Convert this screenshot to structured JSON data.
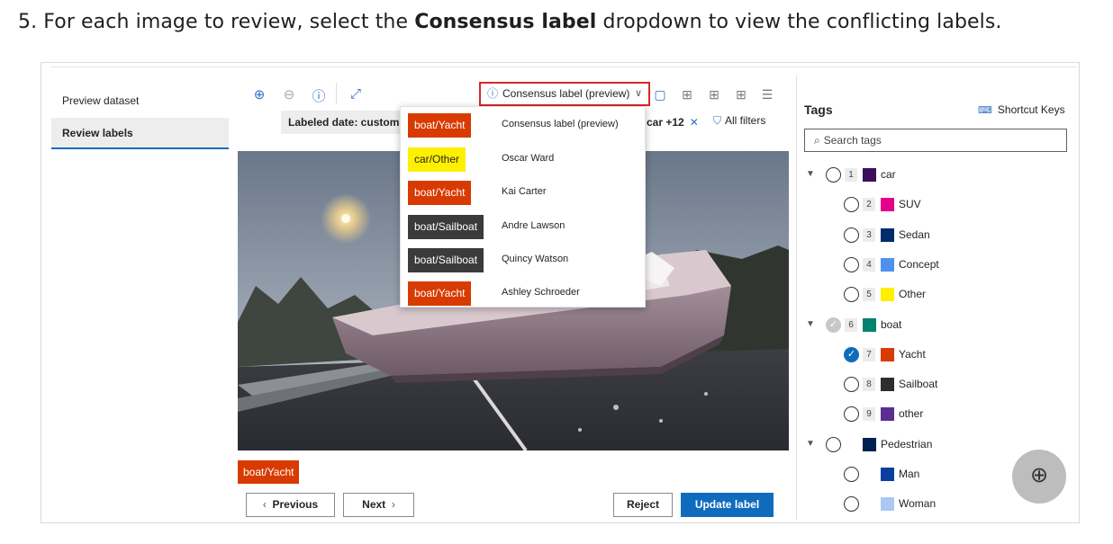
{
  "instruction": {
    "prefix": "5. For each image to review, select the ",
    "bold": "Consensus label",
    "suffix": " dropdown to view the conflicting labels."
  },
  "nav": {
    "preview_dataset": "Preview dataset",
    "review_labels": "Review labels"
  },
  "toolbar": {
    "zoom_in_icon": "zoom-in-icon",
    "zoom_out_icon": "zoom-out-icon",
    "info_icon": "info-icon",
    "expand_icon": "expand-icon",
    "consensus_label": "Consensus label (preview)",
    "filter_labeled_date": "Labeled date: custom",
    "filter_car": "car +12",
    "all_filters": "All filters"
  },
  "dropdown": {
    "rows": [
      {
        "badge": "boat/Yacht",
        "name": "Consensus label (preview)",
        "bg": "#d83b01",
        "fg": "#ffffff"
      },
      {
        "badge": "car/Other",
        "name": "Oscar Ward",
        "bg": "#ffef00",
        "fg": "#242424"
      },
      {
        "badge": "boat/Yacht",
        "name": "Kai Carter",
        "bg": "#d83b01",
        "fg": "#ffffff"
      },
      {
        "badge": "boat/Sailboat",
        "name": "Andre Lawson",
        "bg": "#3b3b3b",
        "fg": "#ffffff"
      },
      {
        "badge": "boat/Sailboat",
        "name": "Quincy Watson",
        "bg": "#3b3b3b",
        "fg": "#ffffff"
      },
      {
        "badge": "boat/Yacht",
        "name": "Ashley Schroeder",
        "bg": "#d83b01",
        "fg": "#ffffff"
      }
    ]
  },
  "image_label": "boat/Yacht",
  "buttons": {
    "previous": "Previous",
    "next": "Next",
    "reject": "Reject",
    "update": "Update label"
  },
  "tags_panel": {
    "title": "Tags",
    "shortcut_keys": "Shortcut Keys",
    "search_placeholder": "Search tags",
    "tags": [
      {
        "num": "1",
        "name": "car",
        "color": "#3b0f5c",
        "state": "empty",
        "group": true
      },
      {
        "num": "2",
        "name": "SUV",
        "color": "#e3008c",
        "state": "empty",
        "group": false
      },
      {
        "num": "3",
        "name": "Sedan",
        "color": "#002c6c",
        "state": "empty",
        "group": false
      },
      {
        "num": "4",
        "name": "Concept",
        "color": "#4f8ff0",
        "state": "empty",
        "group": false
      },
      {
        "num": "5",
        "name": "Other",
        "color": "#ffef00",
        "state": "empty",
        "group": false
      },
      {
        "num": "6",
        "name": "boat",
        "color": "#00826f",
        "state": "partial",
        "group": true
      },
      {
        "num": "7",
        "name": "Yacht",
        "color": "#d83b01",
        "state": "checked",
        "group": false
      },
      {
        "num": "8",
        "name": "Sailboat",
        "color": "#2e2e2e",
        "state": "empty",
        "group": false
      },
      {
        "num": "9",
        "name": "other",
        "color": "#5c2e91",
        "state": "empty",
        "group": false
      },
      {
        "num": "",
        "name": "Pedestrian",
        "color": "#002050",
        "state": "empty",
        "group": true
      },
      {
        "num": "",
        "name": "Man",
        "color": "#0b3f9f",
        "state": "empty",
        "group": false
      },
      {
        "num": "",
        "name": "Woman",
        "color": "#a9c8f5",
        "state": "empty",
        "group": false
      }
    ]
  },
  "colors": {
    "accent": "#0f6cbd",
    "highlight_border": "#d62828",
    "yacht": "#d83b01"
  }
}
